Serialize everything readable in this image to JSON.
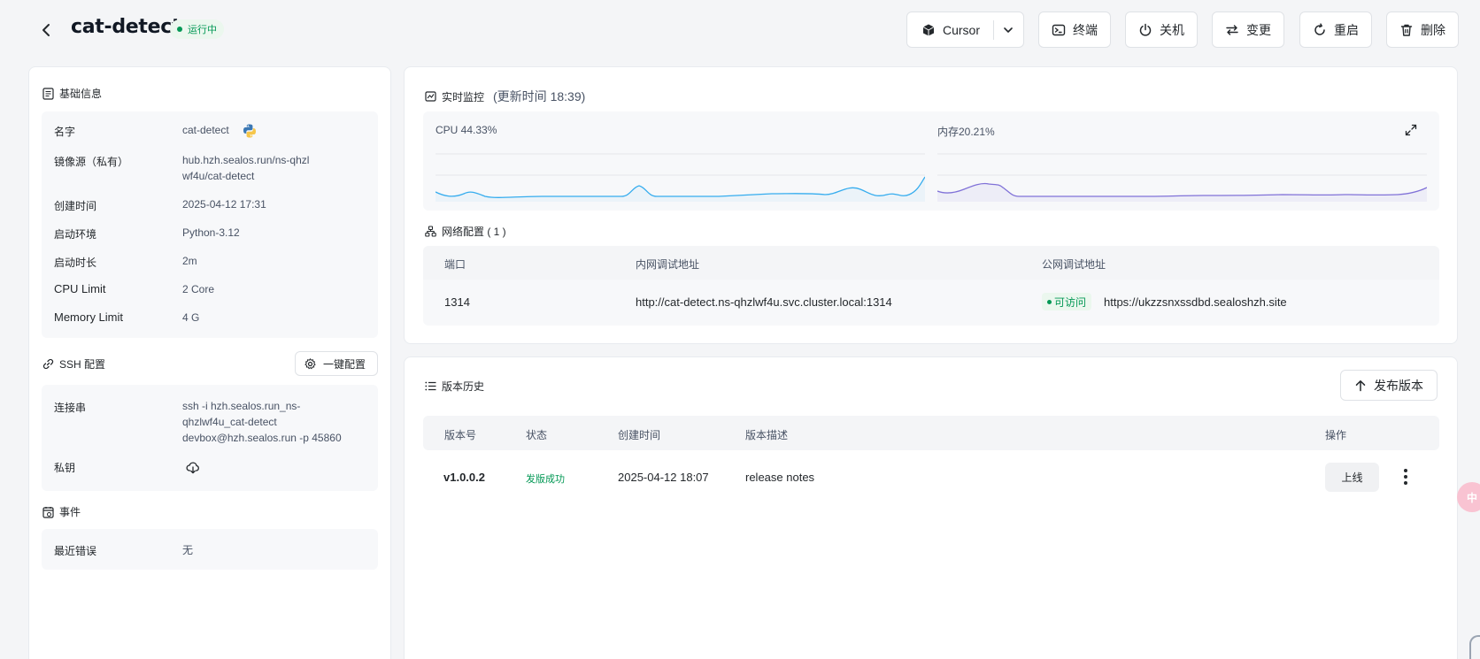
{
  "header": {
    "title": "cat-detect",
    "status": "运行中",
    "ide_label": "Cursor",
    "buttons": {
      "terminal": "终端",
      "shutdown": "关机",
      "change": "变更",
      "restart": "重启",
      "delete": "删除"
    }
  },
  "basic_info": {
    "title": "基础信息",
    "rows": [
      {
        "label": "名字",
        "value": "cat-detect"
      },
      {
        "label": "镜像源（私有）",
        "value": "hub.hzh.sealos.run/ns-qhzlwf4u/cat-detect"
      },
      {
        "label": "创建时间",
        "value": "2025-04-12 17:31"
      },
      {
        "label": "启动环境",
        "value": "Python-3.12"
      },
      {
        "label": "启动时长",
        "value": "2m"
      },
      {
        "label": "CPU Limit",
        "value": "2 Core"
      },
      {
        "label": "Memory Limit",
        "value": "4 G"
      }
    ]
  },
  "ssh": {
    "title": "SSH 配置",
    "config_button": "一键配置",
    "conn_label": "连接串",
    "conn_value": "ssh -i hzh.sealos.run_ns-qhzlwf4u_cat-detect devbox@hzh.sealos.run -p 45860",
    "key_label": "私钥"
  },
  "events": {
    "title": "事件",
    "last_error_label": "最近错误",
    "last_error_value": "无"
  },
  "monitor": {
    "title": "实时监控",
    "updated": "(更新时间  18:39)",
    "cpu_label": "CPU 44.33%",
    "mem_label": "内存20.21%"
  },
  "network": {
    "title": "网络配置 ( 1 )",
    "headers": [
      "端口",
      "内网调试地址",
      "公网调试地址"
    ],
    "rows": [
      {
        "port": "1314",
        "internal": "http://cat-detect.ns-qhzlwf4u.svc.cluster.local:1314",
        "access": "可访问",
        "public": "https://ukzzsnxssdbd.sealoshzh.site"
      }
    ]
  },
  "versions": {
    "title": "版本历史",
    "publish_button": "发布版本",
    "headers": [
      "版本号",
      "状态",
      "创建时间",
      "版本描述",
      "操作"
    ],
    "rows": [
      {
        "version": "v1.0.0.2",
        "status": "发版成功",
        "created": "2025-04-12 18:07",
        "desc": "release notes",
        "action": "上线"
      }
    ]
  },
  "colors": {
    "success": "#039855",
    "cpu_line": "#36ADEF",
    "mem_line": "#8172D8"
  }
}
